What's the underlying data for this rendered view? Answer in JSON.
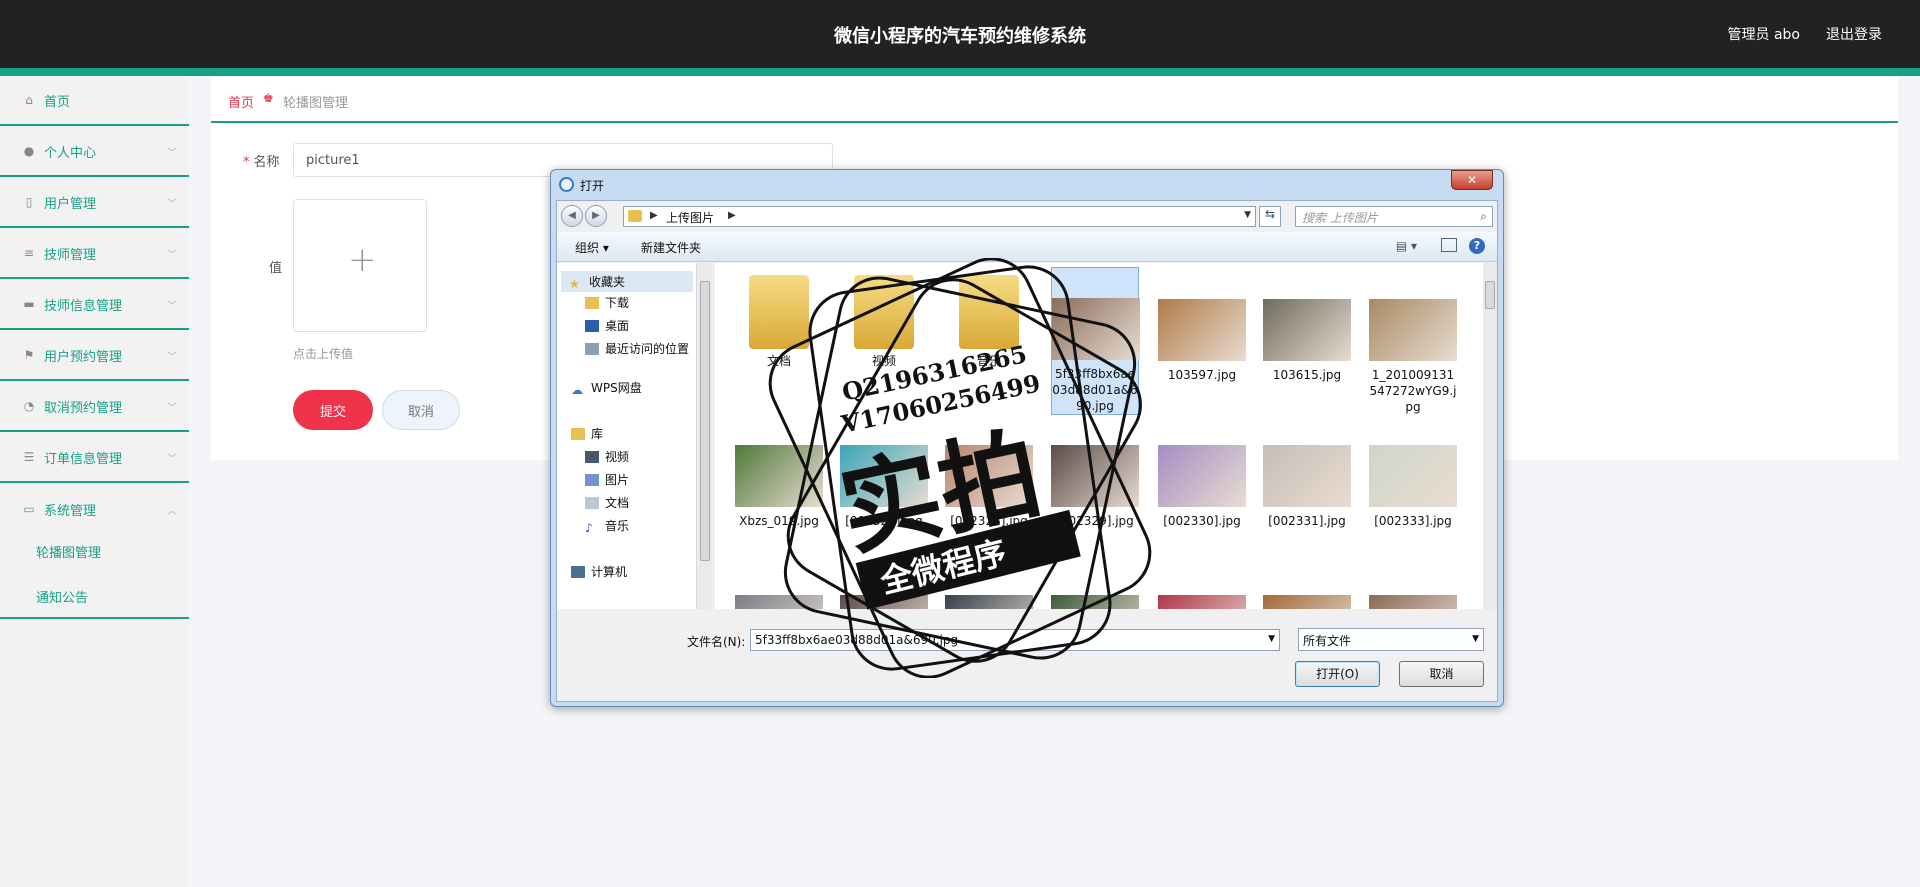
{
  "header": {
    "title": "微信小程序的汽车预约维修系统",
    "admin": "管理员 abo",
    "logout": "退出登录"
  },
  "sidebar": {
    "items": [
      {
        "label": "首页",
        "icon": "home-icon"
      },
      {
        "label": "个人中心",
        "icon": "user-icon"
      },
      {
        "label": "用户管理",
        "icon": "mic-icon"
      },
      {
        "label": "技师管理",
        "icon": "list-icon"
      },
      {
        "label": "技师信息管理",
        "icon": "monitor-icon"
      },
      {
        "label": "用户预约管理",
        "icon": "flag-icon"
      },
      {
        "label": "取消预约管理",
        "icon": "gauge-icon"
      },
      {
        "label": "订单信息管理",
        "icon": "sliders-icon"
      },
      {
        "label": "系统管理",
        "icon": "chat-icon"
      }
    ],
    "sub_items": [
      "轮播图管理",
      "通知公告"
    ]
  },
  "breadcrumb": {
    "home": "首页",
    "current": "轮播图管理"
  },
  "form": {
    "name_label": "名称",
    "name_value": "picture1",
    "value_label": "值",
    "upload_hint": "点击上传值",
    "submit": "提交",
    "cancel": "取消"
  },
  "dialog": {
    "title": "打开",
    "close": "✕",
    "address": "上传图片",
    "search_placeholder": "搜索 上传图片",
    "toolbar": {
      "organize": "组织 ▾",
      "new_folder": "新建文件夹"
    },
    "tree": {
      "favorites": "收藏夹",
      "downloads": "下载",
      "desktop": "桌面",
      "recent": "最近访问的位置",
      "wps": "WPS网盘",
      "library": "库",
      "videos": "视频",
      "pictures": "图片",
      "documents": "文档",
      "music": "音乐",
      "computer": "计算机"
    },
    "files": [
      {
        "name": "文档",
        "kind": "folder"
      },
      {
        "name": "视频",
        "kind": "folder"
      },
      {
        "name": "音乐",
        "kind": "folder"
      },
      {
        "name": "5f33ff8bx6ae03d88d01a&690.jpg",
        "kind": "photo",
        "color": "#8a6d5a",
        "selected": true
      },
      {
        "name": "103597.jpg",
        "kind": "photo",
        "color": "#b07a48"
      },
      {
        "name": "103615.jpg",
        "kind": "photo",
        "color": "#6f6a5f"
      },
      {
        "name": "1_201009131547272wYG9.jpg",
        "kind": "photo",
        "color": "#a78a62"
      },
      {
        "name": "Xbzs_019.jpg",
        "kind": "photo",
        "color": "#4e7a3a"
      },
      {
        "name": "[002327].jpg",
        "kind": "photo",
        "color": "#3aa6b8"
      },
      {
        "name": "[002328].jpg",
        "kind": "photo",
        "color": "#b8866e"
      },
      {
        "name": "[002329].jpg",
        "kind": "photo",
        "color": "#5b4a46"
      },
      {
        "name": "[002330].jpg",
        "kind": "photo",
        "color": "#a48ec4"
      },
      {
        "name": "[002331].jpg",
        "kind": "photo",
        "color": "#c8bdb5"
      },
      {
        "name": "[002333].jpg",
        "kind": "photo",
        "color": "#cfd6c8"
      },
      {
        "name": "",
        "kind": "photo",
        "color": "#7b7f86"
      },
      {
        "name": "",
        "kind": "photo",
        "color": "#5c4a48"
      },
      {
        "name": "",
        "kind": "photo",
        "color": "#35404c"
      },
      {
        "name": "",
        "kind": "photo",
        "color": "#3d5a3a"
      },
      {
        "name": "",
        "kind": "photo",
        "color": "#b0364a"
      },
      {
        "name": "",
        "kind": "photo",
        "color": "#a36a3a"
      },
      {
        "name": "",
        "kind": "photo",
        "color": "#8a6b58"
      }
    ],
    "filename_label": "文件名(N):",
    "filename_value": "5f33ff8bx6ae03d88d01a&690.jpg",
    "filetype": "所有文件",
    "open": "打开(O)",
    "cancel": "取消"
  },
  "watermark": {
    "line1": "Q2196316265",
    "line2": "V17060256499",
    "big": "实拍",
    "banner": "全微程序"
  },
  "colors": {
    "accent": "#16a187",
    "primary_red": "#f0324b",
    "topbar": "#222222"
  }
}
